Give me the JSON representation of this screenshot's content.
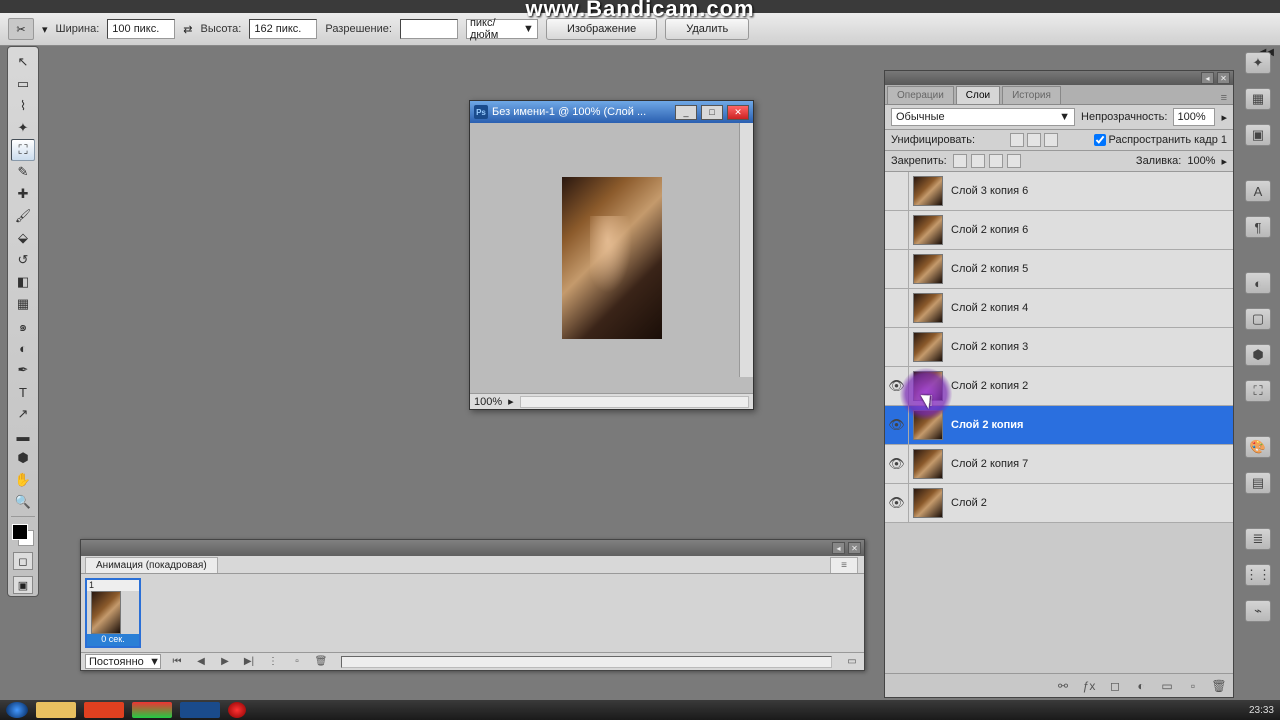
{
  "watermark": "www.Bandicam.com",
  "options_bar": {
    "width_label": "Ширина:",
    "width_value": "100 пикс.",
    "height_label": "Высота:",
    "height_value": "162 пикс.",
    "res_label": "Разрешение:",
    "res_value": "",
    "res_unit": "пикс/дюйм",
    "btn_image": "Изображение",
    "btn_delete": "Удалить"
  },
  "doc": {
    "title": "Без имени-1 @ 100% (Слой ...",
    "zoom": "100%"
  },
  "anim": {
    "title": "Анимация (покадровая)",
    "frame_num": "1",
    "delay": "0 сек.",
    "loop": "Постоянно"
  },
  "panel_tabs": {
    "t1": "Операции",
    "t2": "Слои",
    "t3": "История"
  },
  "blend": {
    "label": "",
    "mode": "Обычные",
    "opacity_label": "Непрозрачность:",
    "opacity": "100%",
    "unify_label": "Унифицировать:",
    "propagate_label": "Распространить кадр 1",
    "lock_label": "Закрепить:",
    "fill_label": "Заливка:",
    "fill": "100%"
  },
  "layers": [
    {
      "name": "Слой 3 копия 6",
      "vis": false
    },
    {
      "name": "Слой 2 копия 6",
      "vis": false
    },
    {
      "name": "Слой 2 копия 5",
      "vis": false
    },
    {
      "name": "Слой 2 копия 4",
      "vis": false
    },
    {
      "name": "Слой 2 копия 3",
      "vis": false
    },
    {
      "name": "Слой 2 копия 2",
      "vis": true
    },
    {
      "name": "Слой 2 копия",
      "vis": true,
      "sel": true
    },
    {
      "name": "Слой 2 копия 7",
      "vis": true
    },
    {
      "name": "Слой 2",
      "vis": true
    }
  ],
  "clock": "23:33"
}
